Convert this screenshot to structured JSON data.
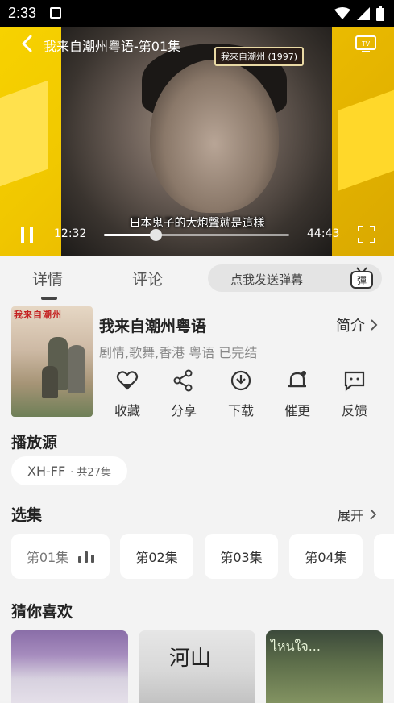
{
  "status_bar": {
    "time": "2:33"
  },
  "player": {
    "title": "我来自潮州粤语-第01集",
    "frame_tag": "我來自潮州 (1997)",
    "subtitle": "日本鬼子的大炮聲就是這樣",
    "current_time": "12:32",
    "total_time": "44:43",
    "progress": 0.28
  },
  "tabs": {
    "detail": "详情",
    "comment": "评论"
  },
  "danmaku": {
    "placeholder": "点我发送弹幕",
    "icon_text": "彈"
  },
  "show": {
    "title": "我来自潮州粤语",
    "intro": "简介",
    "meta": "剧情,歌舞,香港 粤语 已完结",
    "poster_title": "我来自潮州"
  },
  "actions": [
    {
      "label": "收藏",
      "icon": "heart-icon"
    },
    {
      "label": "分享",
      "icon": "share-icon"
    },
    {
      "label": "下载",
      "icon": "download-icon"
    },
    {
      "label": "催更",
      "icon": "bell-icon"
    },
    {
      "label": "反馈",
      "icon": "feedback-icon"
    }
  ],
  "source": {
    "heading": "播放源",
    "name": "XH-FF",
    "count": "· 共27集"
  },
  "episodes": {
    "heading": "选集",
    "expand": "展开",
    "items": [
      "第01集",
      "第02集",
      "第03集",
      "第04集"
    ]
  },
  "recommend": {
    "heading": "猜你喜欢",
    "card2_text": "河山",
    "card3_text": "ไหนใจ..."
  },
  "colors": {
    "accent": "#f7d200",
    "bg": "#f3f3f3"
  }
}
